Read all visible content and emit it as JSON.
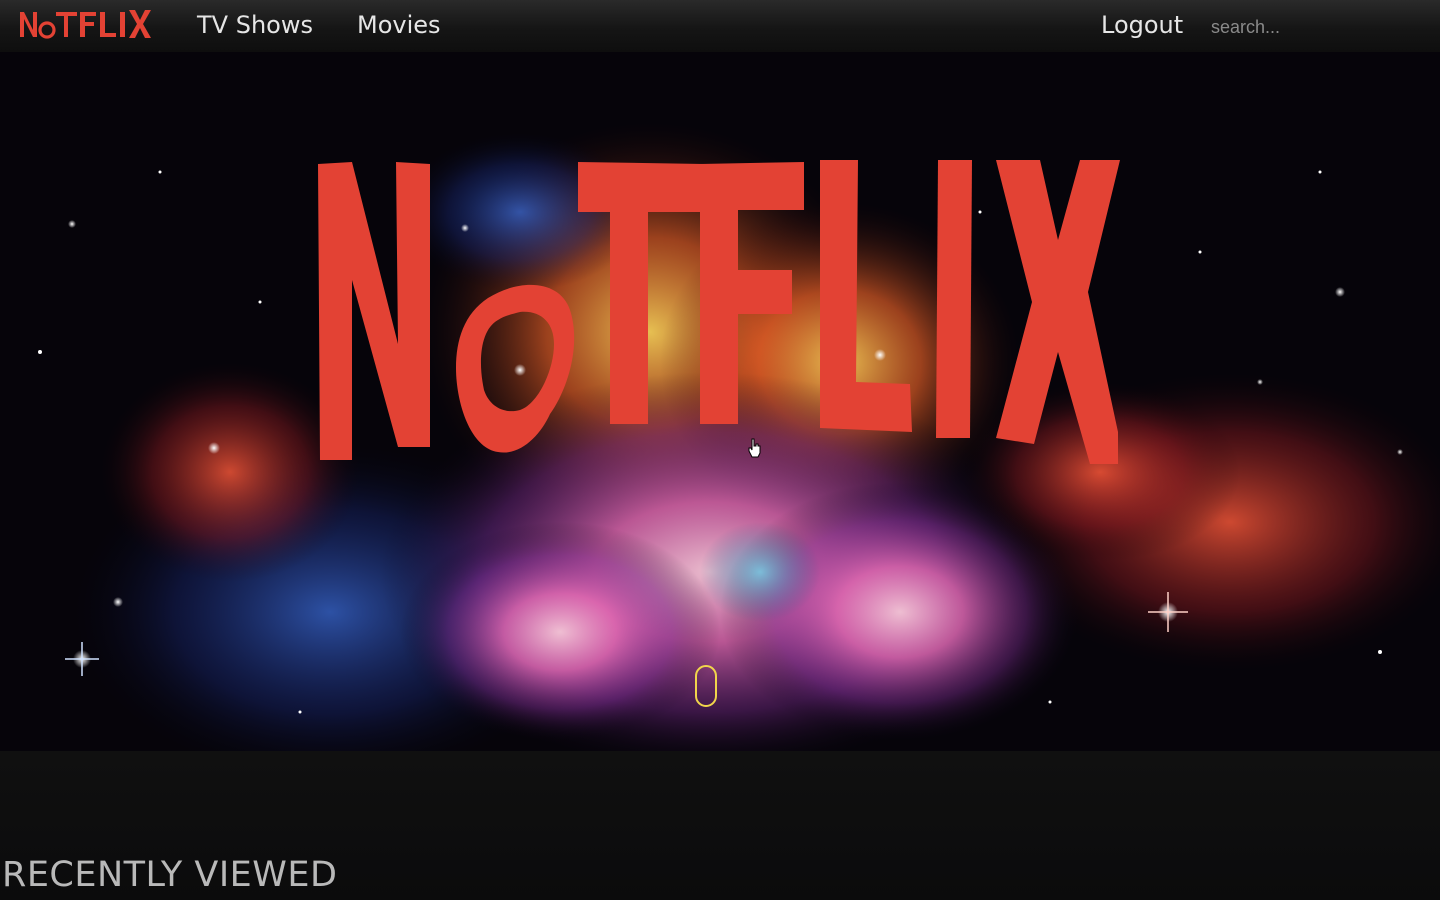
{
  "app": {
    "logo_text": "NoTFLIX",
    "brand_color": "#e34234"
  },
  "nav": {
    "tv_shows": "TV Shows",
    "movies": "Movies",
    "logout": "Logout"
  },
  "search": {
    "placeholder": "search..."
  },
  "hero": {
    "logo_text": "NoTFLIX",
    "background": "galaxy-nebula-image",
    "scroll_indicator": "scroll-mouse-icon"
  },
  "sections": {
    "recently_viewed": "RECENTLY VIEWED"
  },
  "colors": {
    "navbar": "#1a1a1a",
    "page_bg": "#0b0b0c",
    "logo_red": "#e34234",
    "scroll_indicator": "#f1d54b"
  }
}
